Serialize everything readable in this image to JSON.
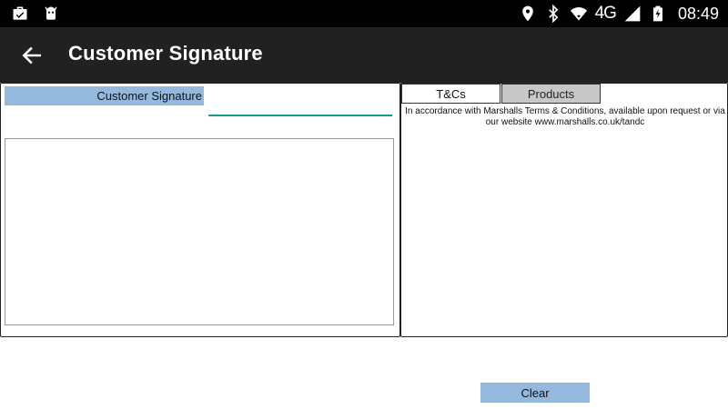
{
  "status_bar": {
    "time": "08:49",
    "network_type": "4G",
    "icons_left": [
      "briefcase-check-icon",
      "android-icon"
    ],
    "icons_right": [
      "location-pin-icon",
      "bluetooth-icon",
      "wifi-icon",
      "signal-icon",
      "battery-charging-icon"
    ]
  },
  "app_bar": {
    "title": "Customer Signature",
    "back_icon": "arrow-left-icon",
    "background": "#212121"
  },
  "signature_panel": {
    "tab_label": "Customer Signature",
    "name_value": "",
    "accent_color": "#14998a"
  },
  "terms_panel": {
    "tabs": [
      {
        "label": "T&Cs",
        "selected": true
      },
      {
        "label": "Products",
        "selected": false
      }
    ],
    "text": "In accordance with Marshalls Terms & Conditions, available upon request or via our website www.marshalls.co.uk/tandc"
  },
  "actions": {
    "clear_label": "Clear",
    "button_color": "#94b9dc"
  }
}
